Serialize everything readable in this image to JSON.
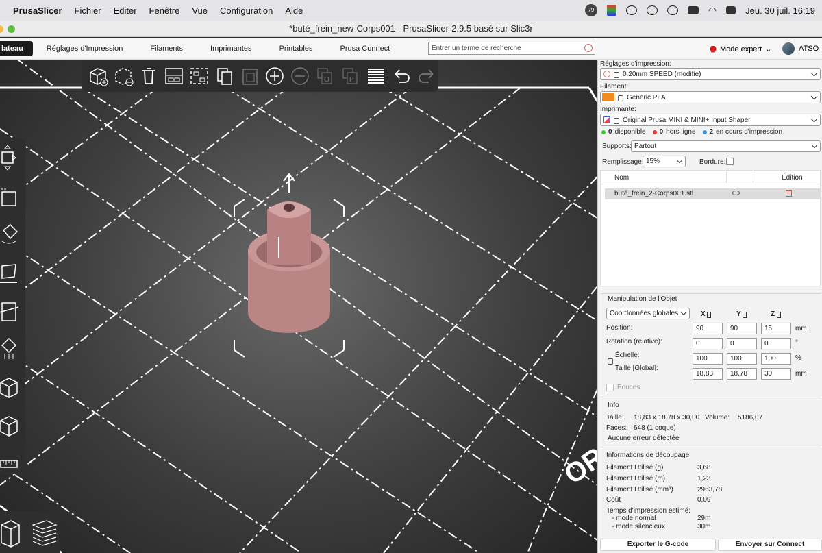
{
  "menubar": {
    "apple": "",
    "items": [
      "PrusaSlicer",
      "Fichier",
      "Editer",
      "Fenêtre",
      "Vue",
      "Configuration",
      "Aide"
    ],
    "notif_count": "79",
    "clock": "Jeu. 30 juil.  16:19"
  },
  "window": {
    "title": "*buté_frein_new-Corps001 - PrusaSlicer-2.9.5 basé sur Slic3r"
  },
  "tabs": [
    "lateau",
    "Réglages d'Impression",
    "Filaments",
    "Imprimantes",
    "Printables",
    "Prusa Connect"
  ],
  "search": {
    "placeholder": "Entrer un terme de recherche"
  },
  "mode": {
    "label": "Mode expert",
    "color": "#d61c1c"
  },
  "user": {
    "name": "ATSO"
  },
  "panel": {
    "print_settings_label": "Réglages d'impression:",
    "print_settings_value": "0.20mm SPEED (modifié)",
    "filament_label": "Filament:",
    "filament_value": "Generic PLA",
    "filament_color": "#f08a1e",
    "printer_label": "Imprimante:",
    "printer_value": "Original Prusa MINI & MINI+ Input Shaper",
    "status": {
      "available_count": "0",
      "available_label": "disponible",
      "offline_count": "0",
      "offline_label": "hors ligne",
      "printing_count": "2",
      "printing_label": "en cours d'impression"
    },
    "supports_label": "Supports:",
    "supports_value": "Partout",
    "infill_label": "Remplissage:",
    "infill_value": "15%",
    "brim_label": "Bordure:",
    "objects": {
      "col_name": "Nom",
      "col_edit": "Édition",
      "rows": [
        {
          "name": "buté_frein_2-Corps001.stl"
        }
      ]
    },
    "manip": {
      "title": "Manipulation de l'Objet",
      "coord_system": "Coordonnées globales",
      "axes": [
        "X",
        "Y",
        "Z"
      ],
      "position_label": "Position:",
      "position": [
        "90",
        "90",
        "15"
      ],
      "position_unit": "mm",
      "rotation_label": "Rotation (relative):",
      "rotation": [
        "0",
        "0",
        "0"
      ],
      "rotation_unit": "°",
      "scale_label": "Échelle:",
      "scale": [
        "100",
        "100",
        "100"
      ],
      "scale_unit": "%",
      "size_label": "Taille [Global]:",
      "size": [
        "18,83",
        "18,78",
        "30"
      ],
      "size_unit": "mm",
      "inches_label": "Pouces"
    },
    "info": {
      "title": "Info",
      "size_label": "Taille:",
      "size_value": "18,83 x 18,78 x 30,00",
      "volume_label": "Volume:",
      "volume_value": "5186,07",
      "faces_label": "Faces:",
      "faces_value": "648 (1 coque)",
      "errors": "Aucune erreur détectée"
    },
    "slicing": {
      "title": "Informations de découpage",
      "rows": [
        {
          "label": "Filament Utilisé (g)",
          "value": "3,68"
        },
        {
          "label": "Filament Utilisé (m)",
          "value": "1,23"
        },
        {
          "label": "Filament Utilisé (mm³)",
          "value": "2963,78"
        },
        {
          "label": "Coût",
          "value": "0,09"
        }
      ],
      "time_label": "Temps d'impression estimé:",
      "normal_label": "- mode normal",
      "normal_value": "29m",
      "silent_label": "- mode silencieux",
      "silent_value": "30m"
    },
    "export_button": "Exporter le G-code",
    "send_button": "Envoyer sur Connect"
  }
}
